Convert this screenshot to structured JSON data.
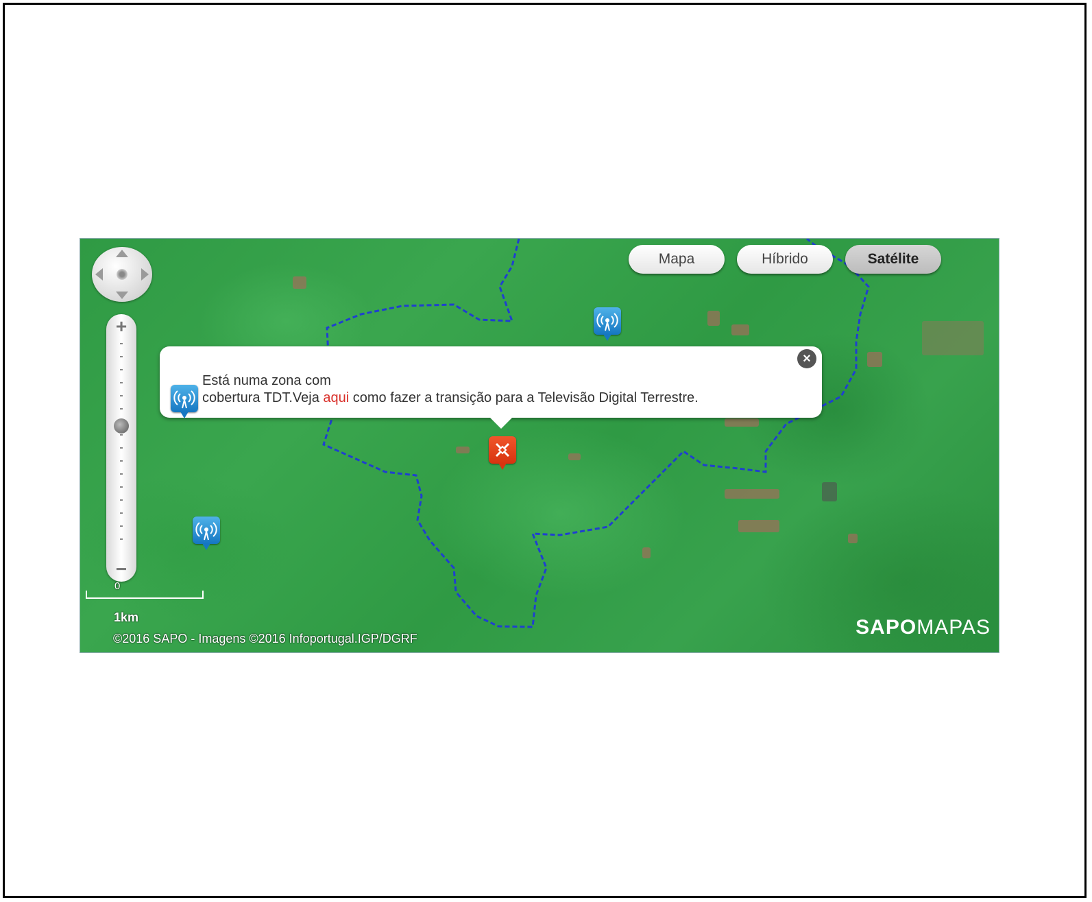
{
  "map": {
    "type_buttons": {
      "map": "Mapa",
      "hybrid": "Híbrido",
      "satellite": "Satélite",
      "active": "satellite"
    },
    "scale": {
      "zero": "0",
      "label": "1km"
    },
    "copyright": "©2016 SAPO - Imagens ©2016 Infoportugal.IGP/DGRF",
    "brand": {
      "bold": "SAPO",
      "light": "MAPAS"
    },
    "popup": {
      "line1": "Está numa zona com",
      "line2_prefix": "cobertura TDT.Veja ",
      "link": "aqui",
      "line2_suffix": " como fazer a transição para a Televisão Digital Terrestre."
    },
    "colors": {
      "boundary": "#1f3fd0",
      "tower_pin": "#1577c2",
      "location_pin": "#e2411a",
      "link": "#d9302a"
    },
    "icons": {
      "tower": "tdt-tower-icon",
      "location": "location-marker-icon",
      "close": "close-icon"
    }
  }
}
